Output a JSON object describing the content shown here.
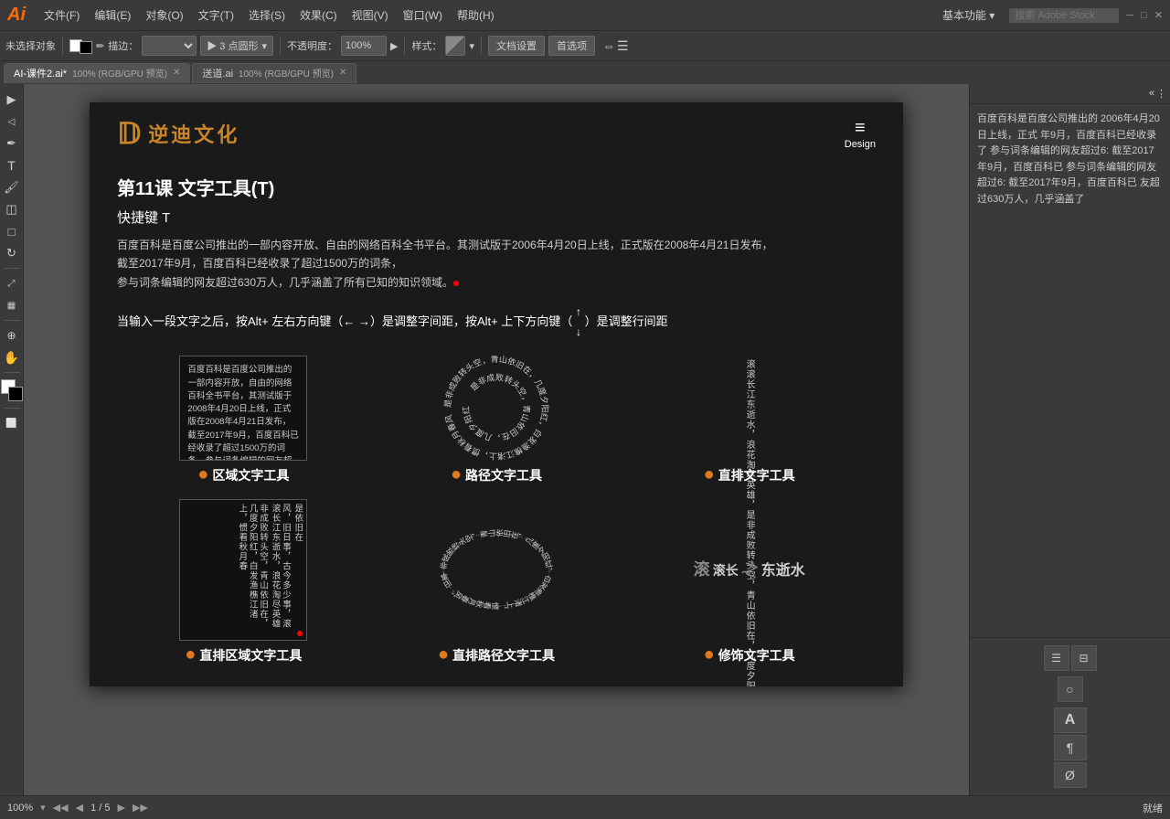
{
  "app": {
    "logo": "Ai",
    "logo_color": "#ff6b00"
  },
  "menubar": {
    "items": [
      "文件(F)",
      "编辑(E)",
      "对象(O)",
      "文字(T)",
      "选择(S)",
      "效果(C)",
      "视图(V)",
      "窗口(W)",
      "帮助(H)"
    ],
    "right": {
      "feature": "基本功能 ▾",
      "search_placeholder": "搜索 Adobe Stock"
    }
  },
  "toolbar": {
    "no_selection": "未选择对象",
    "brush_label": "描边：",
    "point_shape": "▶ 3 点圆形",
    "opacity_label": "不透明度：",
    "opacity_value": "100%",
    "style_label": "样式：",
    "doc_settings": "文档设置",
    "preferences": "首选项"
  },
  "tabs": [
    {
      "name": "AI-课件2.ai*",
      "detail": "100% (RGB/GPU 预览)",
      "active": true
    },
    {
      "name": "送道.ai",
      "detail": "100% (RGB/GPU 预览)",
      "active": false
    }
  ],
  "canvas": {
    "logo_text": "逆迪文化",
    "nav_icon": "≡",
    "nav_label": "Design",
    "lesson_title": "第11课   文字工具(T)",
    "shortcut": "快捷键 T",
    "intro_paragraph": "百度百科是百度公司推出的一部内容开放、自由的网络百科全书平台。其测试版于2006年4月20日上线，正式版在2008年4月21日发布，截至2017年9月，百度百科已经收录了超过1500万的词条，\n参与词条编辑的网友超过630万人，几乎涵盖了所有已知的知识领域。",
    "instruction": "当输入一段文字之后，按Alt+ 左右方向键（← →）是调整字间距，按Alt+ 上下方向键（",
    "instruction2": "）是调整行间距",
    "tools": [
      {
        "name": "区域文字工具",
        "sample_text": "百度百科是百度公司推出的一部内容开放，自由的网络百科全书平台，其测试版于2008年4月20日上线，正式版在2008年4月21日发布，截至2017年9月，百度百科已经收录了超过1500万的词条，参与词条编辑的网友超过630万人，几乎涵盖了所有已知的知识领域。",
        "type": "box"
      },
      {
        "name": "路径文字工具",
        "sample_text": "是非成败转头空，青山依旧在，几度夕阳红，白发渔樵江渚上，惯看秋月春风",
        "type": "circle"
      },
      {
        "name": "直排文字工具",
        "sample_text": "滚滚长江东逝水，浪花淘尽英雄，是非成败转头空，青山依旧在，几度夕阳红，白发渔樵江渚上，惯看秋月春风",
        "type": "vertical"
      }
    ],
    "tools2": [
      {
        "name": "直排区域文字工具",
        "type": "box-vertical"
      },
      {
        "name": "直排路径文字工具",
        "type": "circle-vertical"
      },
      {
        "name": "修饰文字工具",
        "type": "stylized"
      }
    ],
    "right_panel_text": "百度百科是百度公司推出的 2006年4月20日上线，正式 年9月，百度百科已经收录了 参与词条编辑的网友超过6: 截至2017年9月，百度百科已 参与词条编辑的网友超过6: 截至2017年9月，百度百科已 友超过630万人，几乎涵盖了"
  },
  "bottom_bar": {
    "zoom": "100%",
    "page_info": "◀ ▶ 1 / 5 ▶ ▶",
    "status": "就绪"
  }
}
